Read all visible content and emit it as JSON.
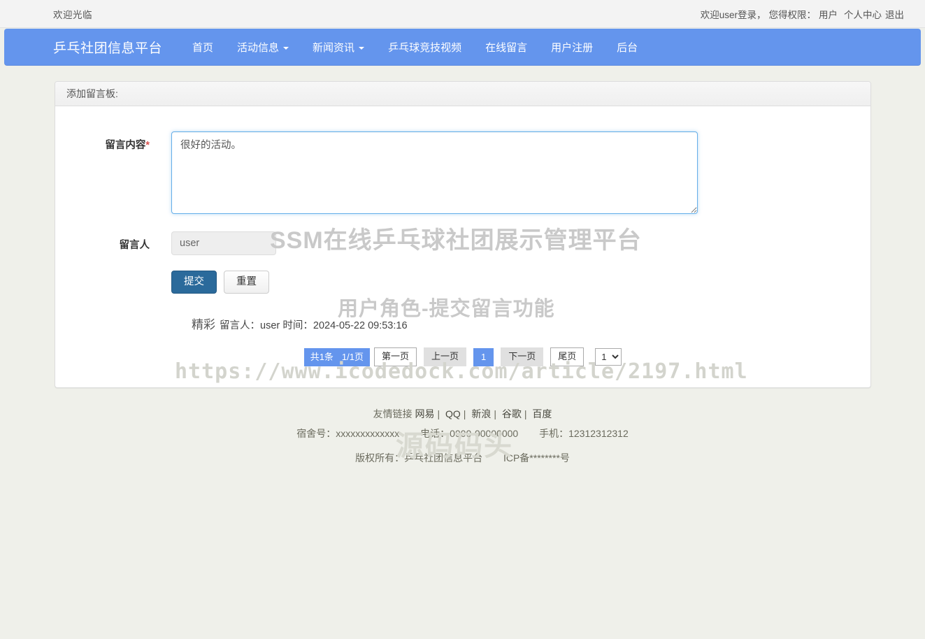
{
  "topbar": {
    "welcome": "欢迎光临",
    "login_info": "欢迎user登录，",
    "role_label": "您得权限：",
    "role_value": "用户",
    "profile_link": "个人中心",
    "logout_link": "退出"
  },
  "navbar": {
    "brand": "乒乓社团信息平台",
    "items": [
      {
        "label": "首页",
        "has_caret": false
      },
      {
        "label": "活动信息",
        "has_caret": true
      },
      {
        "label": "新闻资讯",
        "has_caret": true
      },
      {
        "label": "乒乓球竞技视频",
        "has_caret": false
      },
      {
        "label": "在线留言",
        "has_caret": false
      },
      {
        "label": "用户注册",
        "has_caret": false
      },
      {
        "label": "后台",
        "has_caret": false
      }
    ],
    "color": "#6495ed"
  },
  "panel": {
    "heading": "添加留言板:",
    "form": {
      "content_label": "留言内容",
      "content_required_mark": "*",
      "content_value": "很好的活动。",
      "content_placeholder": "",
      "author_label": "留言人",
      "author_value": "user",
      "submit_label": "提交",
      "reset_label": "重置"
    },
    "messages": [
      {
        "content": "精彩",
        "author_label": "留言人：",
        "author": "user",
        "time_label": "时间：",
        "time": "2024-05-22 09:53:16"
      }
    ],
    "pagination": {
      "total": "共1条",
      "page_of": "1/1页",
      "first": "第一页",
      "prev": "上一页",
      "current": "1",
      "next": "下一页",
      "last": "尾页",
      "page_select_value": "1",
      "page_select_options": [
        "1"
      ]
    }
  },
  "footer": {
    "links_label": "友情链接",
    "links": [
      "网易",
      "QQ",
      "新浪",
      "谷歌",
      "百度"
    ],
    "dorm_label": "宿舍号：",
    "dorm_value": "xxxxxxxxxxxxx",
    "phone_label": "电话：",
    "phone_value": "0000-00000000",
    "mobile_label": "手机：",
    "mobile_value": "12312312312",
    "copyright_label": "版权所有：",
    "copyright_value": "乒乓社团信息平台",
    "icp": "ICP备********号"
  },
  "watermarks": {
    "title": "SSM在线乒乓球社团展示管理平台",
    "subtitle": "用户角色-提交留言功能",
    "url": "https://www.icodedock.com/article/2197.html",
    "brand": "源码码头"
  }
}
